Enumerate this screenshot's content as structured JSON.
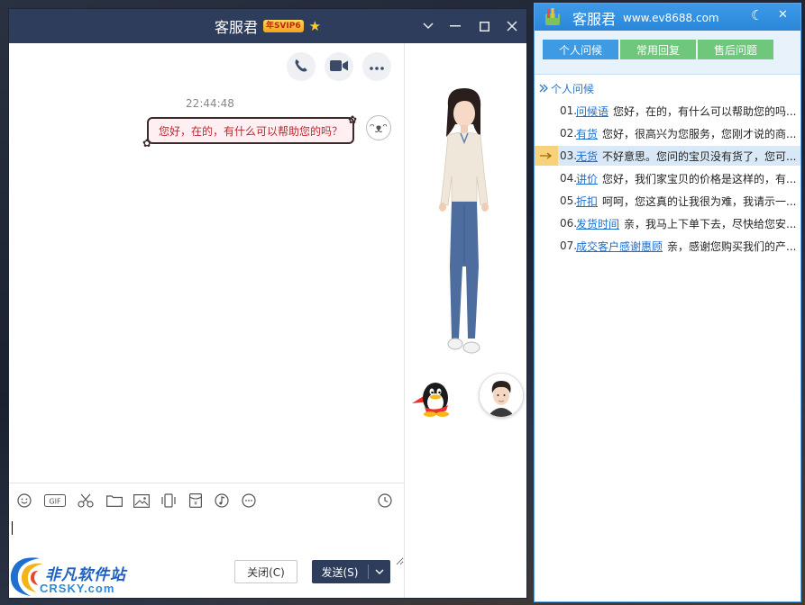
{
  "chat": {
    "title": "客服君",
    "badge": "年SVIP6",
    "timestamp": "22:44:48",
    "message": "您好，在的，有什么可以帮助您的吗？",
    "close_label": "关闭(C)",
    "send_label": "发送(S)"
  },
  "watermark": {
    "name": "非凡软件站",
    "sub": "CRSKY.com"
  },
  "panel": {
    "title": "客服君",
    "url": "www.ev8688.com",
    "tabs": [
      "个人问候",
      "常用回复",
      "售后问题"
    ],
    "section": "个人问候",
    "items": [
      {
        "num": "01.",
        "tag": "问候语",
        "text": "您好，在的，有什么可以帮助您的吗..."
      },
      {
        "num": "02.",
        "tag": "有货",
        "text": "您好，很高兴为您服务，您刚才说的商..."
      },
      {
        "num": "03.",
        "tag": "无货",
        "text": "不好意思。您问的宝贝没有货了，您可..."
      },
      {
        "num": "04.",
        "tag": "讲价",
        "text": "您好，我们家宝贝的价格是这样的，有..."
      },
      {
        "num": "05.",
        "tag": "折扣",
        "text": "呵呵，您这真的让我很为难，我请示一..."
      },
      {
        "num": "06.",
        "tag": "发货时间",
        "text": "亲，我马上下单下去，尽快给您安..."
      },
      {
        "num": "07.",
        "tag": "成交客户感谢惠顾",
        "text": "亲，感谢您购买我们的产..."
      }
    ],
    "selected_index": 2
  },
  "colors": {
    "chat_titlebar": "#2f3d5c",
    "panel_titlebar": "#2a86d9",
    "tab_blue": "#3d9ae3",
    "tab_green": "#6ec77a",
    "selected_marker": "#f7d27a"
  }
}
